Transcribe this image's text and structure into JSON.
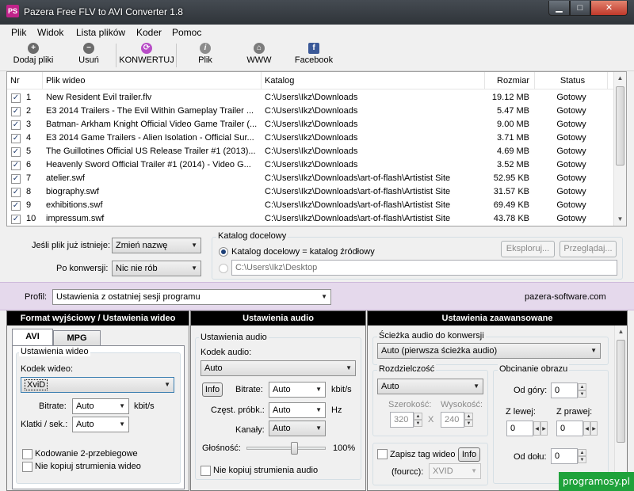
{
  "window": {
    "title": "Pazera Free FLV to AVI Converter 1.8",
    "icon_text": "PS",
    "min_glyph": "▁",
    "max_glyph": "□",
    "close_glyph": "✕"
  },
  "menu": [
    "Plik",
    "Widok",
    "Lista plików",
    "Koder",
    "Pomoc"
  ],
  "toolbar": {
    "add": "Dodaj pliki",
    "remove": "Usuń",
    "convert": "KONWERTUJ",
    "file": "Plik",
    "www": "WWW",
    "facebook": "Facebook",
    "add_glyph": "+",
    "remove_glyph": "−",
    "convert_glyph": "⟳",
    "file_glyph": "i",
    "www_glyph": "⌂",
    "facebook_glyph": "f"
  },
  "filelist": {
    "headers": [
      "Nr",
      "Plik wideo",
      "Katalog",
      "Rozmiar",
      "Status"
    ],
    "rows": [
      {
        "nr": "1",
        "name": "New Resident Evil trailer.flv",
        "dir": "C:\\Users\\Ikz\\Downloads",
        "size": "19.12 MB",
        "status": "Gotowy"
      },
      {
        "nr": "2",
        "name": "E3 2014 Trailers - The Evil Within Gameplay Trailer ...",
        "dir": "C:\\Users\\Ikz\\Downloads",
        "size": "5.47 MB",
        "status": "Gotowy"
      },
      {
        "nr": "3",
        "name": "Batman- Arkham Knight Official Video Game Trailer (...",
        "dir": "C:\\Users\\Ikz\\Downloads",
        "size": "9.00 MB",
        "status": "Gotowy"
      },
      {
        "nr": "4",
        "name": "E3 2014 Game Trailers - Alien Isolation - Official Sur...",
        "dir": "C:\\Users\\Ikz\\Downloads",
        "size": "3.71 MB",
        "status": "Gotowy"
      },
      {
        "nr": "5",
        "name": "The Guillotines Official US Release Trailer #1 (2013)...",
        "dir": "C:\\Users\\Ikz\\Downloads",
        "size": "4.69 MB",
        "status": "Gotowy"
      },
      {
        "nr": "6",
        "name": "Heavenly Sword Official Trailer #1 (2014) - Video G...",
        "dir": "C:\\Users\\Ikz\\Downloads",
        "size": "3.52 MB",
        "status": "Gotowy"
      },
      {
        "nr": "7",
        "name": "atelier.swf",
        "dir": "C:\\Users\\Ikz\\Downloads\\art-of-flash\\Artistist Site",
        "size": "52.95 KB",
        "status": "Gotowy"
      },
      {
        "nr": "8",
        "name": "biography.swf",
        "dir": "C:\\Users\\Ikz\\Downloads\\art-of-flash\\Artistist Site",
        "size": "31.57 KB",
        "status": "Gotowy"
      },
      {
        "nr": "9",
        "name": "exhibitions.swf",
        "dir": "C:\\Users\\Ikz\\Downloads\\art-of-flash\\Artistist Site",
        "size": "69.49 KB",
        "status": "Gotowy"
      },
      {
        "nr": "10",
        "name": "impressum.swf",
        "dir": "C:\\Users\\Ikz\\Downloads\\art-of-flash\\Artistist Site",
        "size": "43.78 KB",
        "status": "Gotowy"
      }
    ],
    "check_glyph": "✓"
  },
  "options": {
    "exists_label": "Jeśli plik już istnieje:",
    "exists_value": "Zmień nazwę",
    "after_label": "Po konwersji:",
    "after_value": "Nic nie rób",
    "target_group": "Katalog docelowy",
    "radio_same": "Katalog docelowy = katalog źródłowy",
    "custom_path": "C:\\Users\\Ikz\\Desktop",
    "explore_btn": "Eksploruj...",
    "browse_btn": "Przeglądaj..."
  },
  "profile": {
    "label": "Profil:",
    "value": "Ustawienia z ostatniej sesji programu",
    "site": "pazera-software.com"
  },
  "video_panel": {
    "header": "Format wyjściowy / Ustawienia wideo",
    "tab_avi": "AVI",
    "tab_mpg": "MPG",
    "group": "Ustawienia wideo",
    "codec_label": "Kodek wideo:",
    "codec_value": "XviD",
    "bitrate_label": "Bitrate:",
    "bitrate_value": "Auto",
    "bitrate_unit": "kbit/s",
    "fps_label": "Klatki / sek.:",
    "fps_value": "Auto",
    "twopass": "Kodowanie 2-przebiegowe",
    "nocopy": "Nie kopiuj strumienia wideo"
  },
  "audio_panel": {
    "header": "Ustawienia audio",
    "group": "Ustawienia audio",
    "codec_label": "Kodek audio:",
    "codec_value": "Auto",
    "info_btn": "Info",
    "bitrate_label": "Bitrate:",
    "bitrate_value": "Auto",
    "bitrate_unit": "kbit/s",
    "sample_label": "Częst. próbk.:",
    "sample_value": "Auto",
    "sample_unit": "Hz",
    "channels_label": "Kanały:",
    "channels_value": "Auto",
    "volume_label": "Głośność:",
    "volume_value": "100%",
    "volume_level": 0.6,
    "nocopy": "Nie kopiuj strumienia audio"
  },
  "advanced_panel": {
    "header": "Ustawienia zaawansowane",
    "track_group": "Ścieżka audio do konwersji",
    "track_value": "Auto (pierwsza ścieżka audio)",
    "res_group": "Rozdzielczość",
    "res_value": "Auto",
    "width_label": "Szerokość:",
    "width_value": "320",
    "height_label": "Wysokość:",
    "height_value": "240",
    "times": "X",
    "crop_group": "Obcinanie obrazu",
    "top_label": "Od góry:",
    "top_value": "0",
    "left_label": "Z lewej:",
    "left_value": "0",
    "right_label": "Z prawej:",
    "right_value": "0",
    "bottom_label": "Od dołu:",
    "bottom_value": "0",
    "tag_label": "Zapisz tag wideo",
    "info_btn": "Info",
    "fourcc_label": "(fourcc):",
    "fourcc_value": "XVID"
  },
  "watermark": "programosy.pl",
  "glyphs": {
    "down": "▼",
    "up": "▲",
    "left": "◀",
    "right": "▶"
  }
}
